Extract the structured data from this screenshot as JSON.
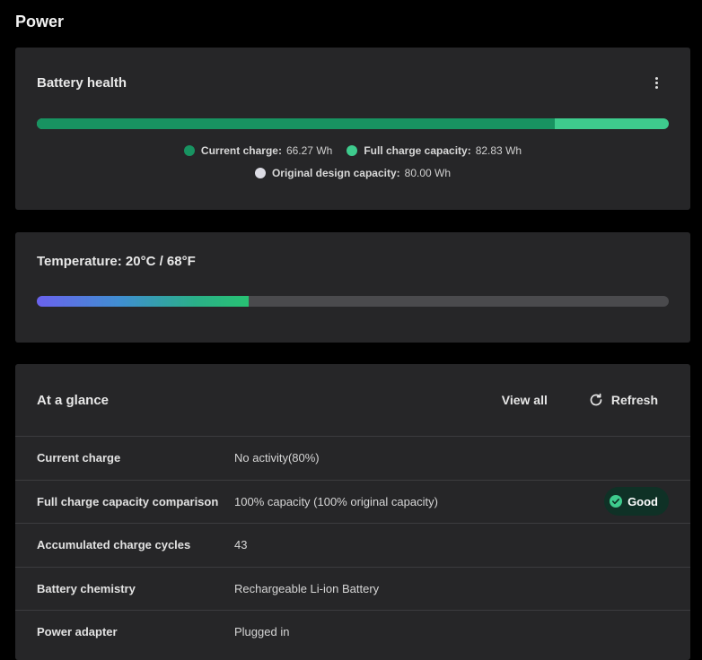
{
  "page": {
    "title": "Power"
  },
  "battery_health": {
    "title": "Battery health",
    "menu_icon": "more-vertical-icon",
    "current_charge_fraction": 0.82,
    "legend": {
      "current_charge": {
        "label": "Current charge:",
        "value": "66.27 Wh",
        "color": "#189361"
      },
      "full_charge": {
        "label": "Full charge capacity:",
        "value": "82.83 Wh",
        "color": "#3ecb8d"
      },
      "design": {
        "label": "Original design capacity:",
        "value": "80.00 Wh",
        "color": "#dcdce4"
      }
    }
  },
  "temperature": {
    "title": "Temperature:  20°C / 68°F",
    "level_fraction": 0.335,
    "gradient_colors": [
      "#6a62ee",
      "#28c273"
    ]
  },
  "glance": {
    "title": "At a glance",
    "view_all_label": "View all",
    "refresh_label": "Refresh",
    "refresh_icon": "refresh-icon",
    "rows": [
      {
        "label": "Current charge",
        "value": "No activity(80%)"
      },
      {
        "label": "Full charge capacity comparison",
        "value": "100% capacity (100% original capacity)",
        "badge": "Good"
      },
      {
        "label": "Accumulated charge cycles",
        "value": "43"
      },
      {
        "label": "Battery chemistry",
        "value": "Rechargeable Li-ion Battery"
      },
      {
        "label": "Power adapter",
        "value": "Plugged in"
      }
    ]
  },
  "colors": {
    "background": "#000000",
    "card": "#262628",
    "accent_green": "#3ecb8d",
    "dark_green": "#189361",
    "badge_bg": "#0f3126"
  }
}
